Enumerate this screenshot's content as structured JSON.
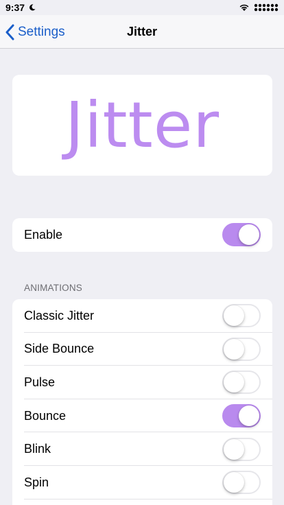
{
  "status": {
    "time": "9:37"
  },
  "nav": {
    "back_label": "Settings",
    "title": "Jitter"
  },
  "hero": {
    "text": "Jitter",
    "color": "#bc8cf0"
  },
  "enable": {
    "label": "Enable",
    "on": true
  },
  "animations": {
    "header": "ANIMATIONS",
    "items": [
      {
        "label": "Classic Jitter",
        "on": false
      },
      {
        "label": "Side Bounce",
        "on": false
      },
      {
        "label": "Pulse",
        "on": false
      },
      {
        "label": "Bounce",
        "on": true
      },
      {
        "label": "Blink",
        "on": false
      },
      {
        "label": "Spin",
        "on": false
      }
    ]
  },
  "colors": {
    "accent": "#b98aee",
    "link": "#1a5ec9",
    "background": "#efeff4"
  }
}
